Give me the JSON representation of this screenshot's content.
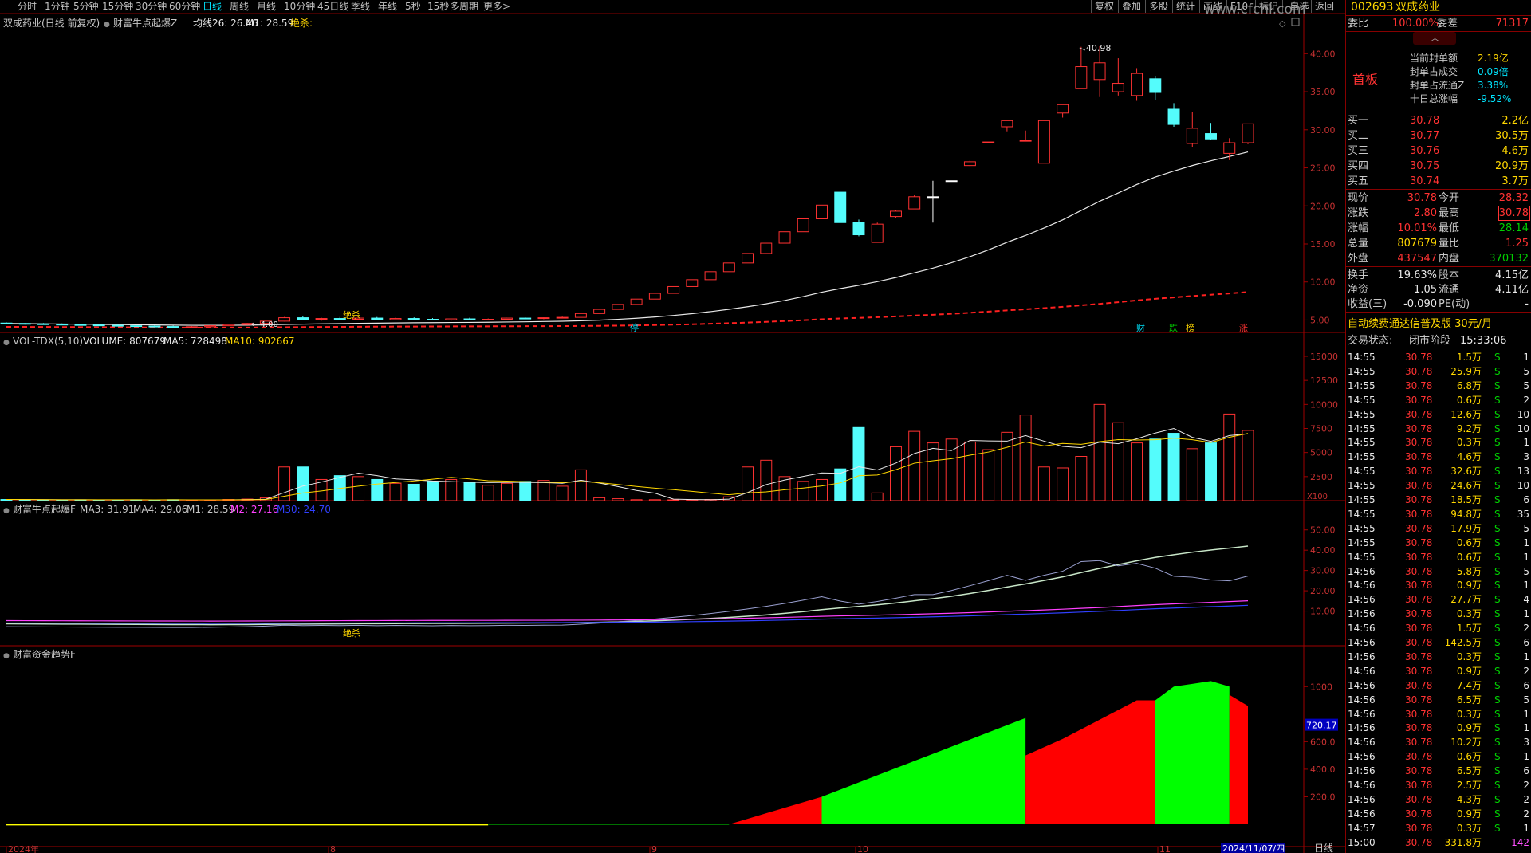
{
  "toolbar": {
    "tabs": [
      "分时",
      "1分钟",
      "5分钟",
      "15分钟",
      "30分钟",
      "60分钟",
      "日线",
      "周线",
      "月线",
      "10分钟",
      "45日线",
      "季线",
      "年线",
      "5秒",
      "15秒",
      "多周期",
      "更多>"
    ],
    "active_tab": "日线",
    "right_buttons": [
      "复权",
      "叠加",
      "多股",
      "统计",
      "画线",
      "F10",
      "标记",
      "-自选",
      "返回"
    ]
  },
  "watermark": "www.cfchi.com",
  "main_panel": {
    "title": "双成药业(日线 前复权)",
    "indicator_name": "财富牛点起爆Z",
    "ma26_label": "均线26: 26.46",
    "m1_label": "M1: 28.59",
    "signal_label": "绝杀:",
    "peak_label": "40.98",
    "low_label": "4.00",
    "jue_sha_mark": "绝杀",
    "badges": [
      {
        "text": "停",
        "color": "#00e5ff"
      },
      {
        "text": "财",
        "color": "#00e5ff"
      },
      {
        "text": "跌",
        "color": "#00d000"
      },
      {
        "text": "榜",
        "color": "#ffd700"
      },
      {
        "text": "涨",
        "color": "#ff3232"
      }
    ],
    "y_ticks": [
      "40.00",
      "35.00",
      "30.00",
      "25.00",
      "20.00",
      "15.00",
      "10.00",
      "5.00"
    ]
  },
  "vol_panel": {
    "name": "VOL-TDX(5,10)",
    "volume": "VOLUME: 807679",
    "ma5": "MA5: 728498",
    "ma10": "MA10: 902667",
    "unit": "X100",
    "y_ticks": [
      "15000",
      "12500",
      "10000",
      "7500",
      "5000",
      "2500"
    ]
  },
  "ind_panel": {
    "name": "财富牛点起爆F",
    "ma3": "MA3: 31.91",
    "ma4": "MA4: 29.06",
    "m1": "M1: 28.59",
    "m2": "M2: 27.16",
    "m30": "M30: 24.70",
    "mark": "绝杀",
    "y_ticks": [
      "50.00",
      "40.00",
      "30.00",
      "20.00",
      "10.00"
    ]
  },
  "money_panel": {
    "name": "财富资金趋势F",
    "current": "720.17",
    "y_ticks": [
      "1000",
      "600.0",
      "400.0",
      "200.0"
    ]
  },
  "date_axis": {
    "labels": [
      "2024年",
      "8",
      "9",
      "10",
      "11"
    ],
    "current_date": "2024/11/07/四",
    "period": "日线"
  },
  "chart_data": {
    "type": "candlestick",
    "symbol": "002693",
    "name": "双成药业",
    "ylim": [
      4.0,
      41.5
    ],
    "candles": [
      {
        "o": 4.6,
        "h": 4.7,
        "l": 4.5,
        "c": 4.55
      },
      {
        "o": 4.55,
        "h": 4.6,
        "l": 4.4,
        "c": 4.5
      },
      {
        "o": 4.5,
        "h": 4.6,
        "l": 4.4,
        "c": 4.45
      },
      {
        "o": 4.45,
        "h": 4.55,
        "l": 4.35,
        "c": 4.4
      },
      {
        "o": 4.4,
        "h": 4.5,
        "l": 4.3,
        "c": 4.35
      },
      {
        "o": 4.35,
        "h": 4.45,
        "l": 4.25,
        "c": 4.3
      },
      {
        "o": 4.3,
        "h": 4.4,
        "l": 4.2,
        "c": 4.25
      },
      {
        "o": 4.25,
        "h": 4.35,
        "l": 4.15,
        "c": 4.2
      },
      {
        "o": 4.2,
        "h": 4.3,
        "l": 4.1,
        "c": 4.15
      },
      {
        "o": 4.15,
        "h": 4.25,
        "l": 4.05,
        "c": 4.1
      },
      {
        "o": 4.1,
        "h": 4.2,
        "l": 4.0,
        "c": 4.12
      },
      {
        "o": 4.12,
        "h": 4.3,
        "l": 4.05,
        "c": 4.25
      },
      {
        "o": 4.25,
        "h": 4.45,
        "l": 4.2,
        "c": 4.4
      },
      {
        "o": 4.4,
        "h": 4.6,
        "l": 4.35,
        "c": 4.55
      },
      {
        "o": 4.55,
        "h": 4.9,
        "l": 4.5,
        "c": 4.85
      },
      {
        "o": 4.85,
        "h": 5.4,
        "l": 4.8,
        "c": 5.3
      },
      {
        "o": 5.3,
        "h": 5.5,
        "l": 5.0,
        "c": 5.1
      },
      {
        "o": 5.1,
        "h": 5.3,
        "l": 4.9,
        "c": 5.2
      },
      {
        "o": 5.2,
        "h": 5.4,
        "l": 5.0,
        "c": 5.1
      },
      {
        "o": 5.1,
        "h": 5.3,
        "l": 4.95,
        "c": 5.25
      },
      {
        "o": 5.25,
        "h": 5.4,
        "l": 5.0,
        "c": 5.05
      },
      {
        "o": 5.05,
        "h": 5.3,
        "l": 4.95,
        "c": 5.2
      },
      {
        "o": 5.2,
        "h": 5.35,
        "l": 5.0,
        "c": 5.1
      },
      {
        "o": 5.1,
        "h": 5.25,
        "l": 4.95,
        "c": 5.0
      },
      {
        "o": 5.0,
        "h": 5.2,
        "l": 4.9,
        "c": 5.15
      },
      {
        "o": 5.15,
        "h": 5.3,
        "l": 5.0,
        "c": 5.05
      },
      {
        "o": 5.05,
        "h": 5.2,
        "l": 4.95,
        "c": 5.1
      },
      {
        "o": 5.1,
        "h": 5.3,
        "l": 5.0,
        "c": 5.25
      },
      {
        "o": 5.25,
        "h": 5.35,
        "l": 5.1,
        "c": 5.2
      },
      {
        "o": 5.2,
        "h": 5.35,
        "l": 5.1,
        "c": 5.3
      },
      {
        "o": 5.3,
        "h": 5.45,
        "l": 5.2,
        "c": 5.35
      },
      {
        "o": 5.35,
        "h": 5.9,
        "l": 5.3,
        "c": 5.85
      },
      {
        "o": 5.85,
        "h": 6.4,
        "l": 5.85,
        "c": 6.4
      },
      {
        "o": 6.4,
        "h": 7.05,
        "l": 6.4,
        "c": 7.05
      },
      {
        "o": 7.05,
        "h": 7.75,
        "l": 7.05,
        "c": 7.75
      },
      {
        "o": 7.75,
        "h": 8.5,
        "l": 7.75,
        "c": 8.5
      },
      {
        "o": 8.5,
        "h": 9.4,
        "l": 8.5,
        "c": 9.4
      },
      {
        "o": 9.4,
        "h": 10.3,
        "l": 9.4,
        "c": 10.3
      },
      {
        "o": 10.3,
        "h": 11.35,
        "l": 10.3,
        "c": 11.35
      },
      {
        "o": 11.35,
        "h": 12.5,
        "l": 11.35,
        "c": 12.5
      },
      {
        "o": 12.5,
        "h": 13.75,
        "l": 12.5,
        "c": 13.75
      },
      {
        "o": 13.75,
        "h": 15.1,
        "l": 13.75,
        "c": 15.1
      },
      {
        "o": 15.1,
        "h": 16.6,
        "l": 15.1,
        "c": 16.6
      },
      {
        "o": 16.6,
        "h": 18.3,
        "l": 16.6,
        "c": 18.3
      },
      {
        "o": 18.3,
        "h": 20.1,
        "l": 18.3,
        "c": 20.1
      },
      {
        "o": 21.8,
        "h": 21.8,
        "l": 17.8,
        "c": 17.8
      },
      {
        "o": 17.8,
        "h": 18.2,
        "l": 16.0,
        "c": 16.2
      },
      {
        "o": 15.2,
        "h": 17.8,
        "l": 15.2,
        "c": 17.6
      },
      {
        "o": 18.6,
        "h": 19.4,
        "l": 18.4,
        "c": 19.3
      },
      {
        "o": 19.6,
        "h": 21.4,
        "l": 19.6,
        "c": 21.2
      },
      {
        "o": 21.2,
        "h": 23.3,
        "l": 17.8,
        "c": 21.2
      },
      {
        "o": 23.3,
        "h": 23.3,
        "l": 23.3,
        "c": 23.3
      },
      {
        "o": 25.3,
        "h": 26.0,
        "l": 25.2,
        "c": 25.8
      },
      {
        "o": 28.3,
        "h": 28.4,
        "l": 28.3,
        "c": 28.4
      },
      {
        "o": 30.4,
        "h": 31.3,
        "l": 29.8,
        "c": 31.2
      },
      {
        "o": 28.5,
        "h": 29.9,
        "l": 28.5,
        "c": 28.6
      },
      {
        "o": 25.6,
        "h": 31.2,
        "l": 25.6,
        "c": 31.2
      },
      {
        "o": 32.2,
        "h": 33.4,
        "l": 31.6,
        "c": 33.3
      },
      {
        "o": 35.4,
        "h": 40.9,
        "l": 35.4,
        "c": 38.3
      },
      {
        "o": 36.6,
        "h": 40.98,
        "l": 34.3,
        "c": 38.8
      },
      {
        "o": 35.0,
        "h": 39.4,
        "l": 34.5,
        "c": 36.1
      },
      {
        "o": 34.5,
        "h": 38.1,
        "l": 33.8,
        "c": 37.4
      },
      {
        "o": 36.7,
        "h": 37.1,
        "l": 33.9,
        "c": 34.9
      },
      {
        "o": 32.7,
        "h": 33.5,
        "l": 30.4,
        "c": 30.7
      },
      {
        "o": 28.2,
        "h": 32.3,
        "l": 27.7,
        "c": 30.2
      },
      {
        "o": 29.5,
        "h": 30.9,
        "l": 28.7,
        "c": 28.8
      },
      {
        "o": 26.9,
        "h": 28.9,
        "l": 26.0,
        "c": 28.3
      },
      {
        "o": 28.3,
        "h": 30.8,
        "l": 28.1,
        "c": 30.78
      }
    ],
    "colors": {
      "up": "#ff3232",
      "down": "#54fcfc",
      "flat": "#ffffff"
    }
  },
  "right_panel": {
    "code": "002693",
    "name": "双成药业",
    "weibi_label": "委比",
    "weibi_val": "100.00%",
    "weicha_label": "委差",
    "weicha_val": "71317",
    "first_board": "首板",
    "seal_lines": [
      {
        "k": "当前封单额",
        "v": "2.19亿"
      },
      {
        "k": "封单占成交",
        "v": "0.09倍"
      },
      {
        "k": "封单占流通Z",
        "v": "3.38%"
      },
      {
        "k": "十日总涨幅",
        "v": "-9.52%"
      }
    ],
    "bids": [
      {
        "k": "买一",
        "p": "30.78",
        "v": "2.2亿"
      },
      {
        "k": "买二",
        "p": "30.77",
        "v": "30.5万"
      },
      {
        "k": "买三",
        "p": "30.76",
        "v": "4.6万"
      },
      {
        "k": "买四",
        "p": "30.75",
        "v": "20.9万"
      },
      {
        "k": "买五",
        "p": "30.74",
        "v": "3.7万"
      }
    ],
    "quote": [
      {
        "k1": "现价",
        "v1": "30.78",
        "k2": "今开",
        "v2": "28.32"
      },
      {
        "k1": "涨跌",
        "v1": "2.80",
        "k2": "最高",
        "v2": "30.78"
      },
      {
        "k1": "涨幅",
        "v1": "10.01%",
        "k2": "最低",
        "v2": "28.14"
      },
      {
        "k1": "总量",
        "v1": "807679",
        "k2": "量比",
        "v2": "1.25"
      },
      {
        "k1": "外盘",
        "v1": "437547",
        "k2": "内盘",
        "v2": "370132"
      }
    ],
    "fundamentals": [
      {
        "k1": "换手",
        "v1": "19.63%",
        "k2": "股本",
        "v2": "4.15亿"
      },
      {
        "k1": "净资",
        "v1": "1.05",
        "k2": "流通",
        "v2": "4.11亿"
      },
      {
        "k1": "收益(三)",
        "v1": "-0.090",
        "k2": "PE(动)",
        "v2": "-"
      }
    ],
    "promo": "自动续费通达信普及版  30元/月",
    "trade_status_label": "交易状态:",
    "trade_status": "闭市阶段",
    "trade_time": "15:33:06",
    "ticks": [
      {
        "t": "14:55",
        "p": "30.78",
        "v": "1.5万",
        "s": "S",
        "n": "1"
      },
      {
        "t": "14:55",
        "p": "30.78",
        "v": "25.9万",
        "s": "S",
        "n": "5"
      },
      {
        "t": "14:55",
        "p": "30.78",
        "v": "6.8万",
        "s": "S",
        "n": "5"
      },
      {
        "t": "14:55",
        "p": "30.78",
        "v": "0.6万",
        "s": "S",
        "n": "2"
      },
      {
        "t": "14:55",
        "p": "30.78",
        "v": "12.6万",
        "s": "S",
        "n": "10"
      },
      {
        "t": "14:55",
        "p": "30.78",
        "v": "9.2万",
        "s": "S",
        "n": "10"
      },
      {
        "t": "14:55",
        "p": "30.78",
        "v": "0.3万",
        "s": "S",
        "n": "1"
      },
      {
        "t": "14:55",
        "p": "30.78",
        "v": "4.6万",
        "s": "S",
        "n": "3"
      },
      {
        "t": "14:55",
        "p": "30.78",
        "v": "32.6万",
        "s": "S",
        "n": "13"
      },
      {
        "t": "14:55",
        "p": "30.78",
        "v": "24.6万",
        "s": "S",
        "n": "10"
      },
      {
        "t": "14:55",
        "p": "30.78",
        "v": "18.5万",
        "s": "S",
        "n": "6"
      },
      {
        "t": "14:55",
        "p": "30.78",
        "v": "94.8万",
        "s": "S",
        "n": "35"
      },
      {
        "t": "14:55",
        "p": "30.78",
        "v": "17.9万",
        "s": "S",
        "n": "5"
      },
      {
        "t": "14:55",
        "p": "30.78",
        "v": "0.6万",
        "s": "S",
        "n": "1"
      },
      {
        "t": "14:55",
        "p": "30.78",
        "v": "0.6万",
        "s": "S",
        "n": "1"
      },
      {
        "t": "14:56",
        "p": "30.78",
        "v": "5.8万",
        "s": "S",
        "n": "5"
      },
      {
        "t": "14:56",
        "p": "30.78",
        "v": "0.9万",
        "s": "S",
        "n": "1"
      },
      {
        "t": "14:56",
        "p": "30.78",
        "v": "27.7万",
        "s": "S",
        "n": "4"
      },
      {
        "t": "14:56",
        "p": "30.78",
        "v": "0.3万",
        "s": "S",
        "n": "1"
      },
      {
        "t": "14:56",
        "p": "30.78",
        "v": "1.5万",
        "s": "S",
        "n": "2"
      },
      {
        "t": "14:56",
        "p": "30.78",
        "v": "142.5万",
        "s": "S",
        "n": "6"
      },
      {
        "t": "14:56",
        "p": "30.78",
        "v": "0.3万",
        "s": "S",
        "n": "1"
      },
      {
        "t": "14:56",
        "p": "30.78",
        "v": "0.9万",
        "s": "S",
        "n": "2"
      },
      {
        "t": "14:56",
        "p": "30.78",
        "v": "7.4万",
        "s": "S",
        "n": "6"
      },
      {
        "t": "14:56",
        "p": "30.78",
        "v": "6.5万",
        "s": "S",
        "n": "5"
      },
      {
        "t": "14:56",
        "p": "30.78",
        "v": "0.3万",
        "s": "S",
        "n": "1"
      },
      {
        "t": "14:56",
        "p": "30.78",
        "v": "0.9万",
        "s": "S",
        "n": "1"
      },
      {
        "t": "14:56",
        "p": "30.78",
        "v": "10.2万",
        "s": "S",
        "n": "3"
      },
      {
        "t": "14:56",
        "p": "30.78",
        "v": "0.6万",
        "s": "S",
        "n": "1"
      },
      {
        "t": "14:56",
        "p": "30.78",
        "v": "6.5万",
        "s": "S",
        "n": "6"
      },
      {
        "t": "14:56",
        "p": "30.78",
        "v": "2.5万",
        "s": "S",
        "n": "2"
      },
      {
        "t": "14:56",
        "p": "30.78",
        "v": "4.3万",
        "s": "S",
        "n": "2"
      },
      {
        "t": "14:56",
        "p": "30.78",
        "v": "0.9万",
        "s": "S",
        "n": "2"
      },
      {
        "t": "14:57",
        "p": "30.78",
        "v": "0.3万",
        "s": "S",
        "n": "1"
      },
      {
        "t": "15:00",
        "p": "30.78",
        "v": "331.8万",
        "s": "",
        "n": "142"
      }
    ]
  }
}
